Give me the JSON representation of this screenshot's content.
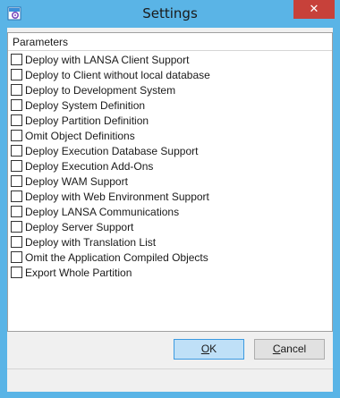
{
  "window": {
    "title": "Settings",
    "close_label": "✕",
    "colors": {
      "frame": "#5ab4e6",
      "close": "#c7413a",
      "ok_fill": "#bfe0f7",
      "ok_border": "#3c9ae0"
    }
  },
  "group": {
    "title": "Parameters"
  },
  "parameters": [
    {
      "label": "Deploy with LANSA Client Support",
      "checked": false
    },
    {
      "label": "Deploy to Client without local database",
      "checked": false
    },
    {
      "label": "Deploy to Development System",
      "checked": false
    },
    {
      "label": "Deploy System Definition",
      "checked": false
    },
    {
      "label": "Deploy Partition Definition",
      "checked": false
    },
    {
      "label": "Omit Object Definitions",
      "checked": false
    },
    {
      "label": "Deploy Execution Database Support",
      "checked": false
    },
    {
      "label": "Deploy Execution Add-Ons",
      "checked": false
    },
    {
      "label": "Deploy WAM Support",
      "checked": false
    },
    {
      "label": "Deploy with Web Environment Support",
      "checked": false
    },
    {
      "label": "Deploy LANSA Communications",
      "checked": false
    },
    {
      "label": "Deploy Server Support",
      "checked": false
    },
    {
      "label": "Deploy with Translation List",
      "checked": false
    },
    {
      "label": "Omit the Application Compiled Objects",
      "checked": false
    },
    {
      "label": "Export Whole Partition",
      "checked": false
    }
  ],
  "buttons": {
    "ok": {
      "mnemonic": "O",
      "rest": "K"
    },
    "cancel": {
      "mnemonic": "C",
      "rest": "ancel"
    }
  },
  "icons": {
    "app": "settings-app-icon",
    "close": "close-icon",
    "checkbox": "checkbox-unchecked"
  }
}
